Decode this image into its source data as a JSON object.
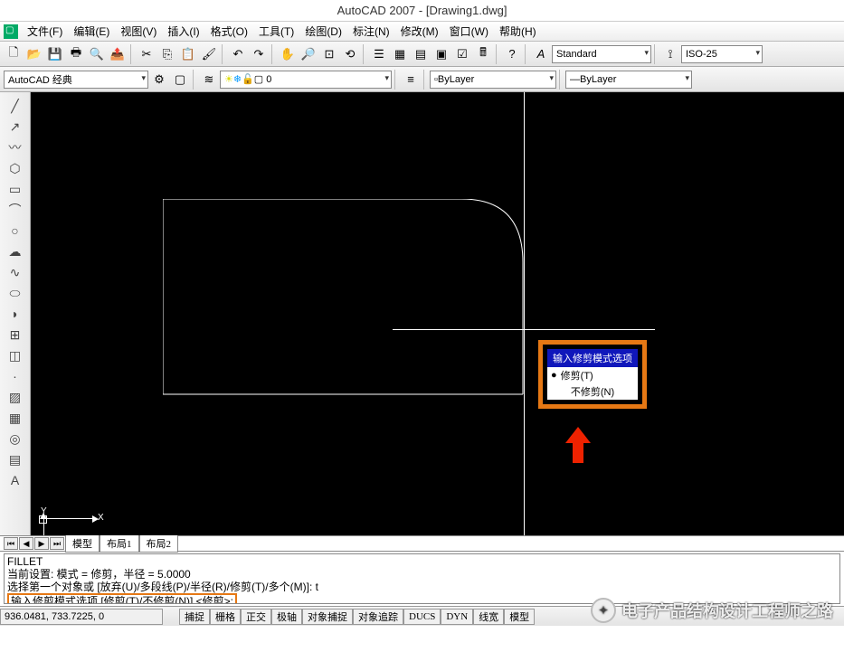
{
  "title": "AutoCAD 2007 - [Drawing1.dwg]",
  "menu": [
    "文件(F)",
    "编辑(E)",
    "视图(V)",
    "插入(I)",
    "格式(O)",
    "工具(T)",
    "绘图(D)",
    "标注(N)",
    "修改(M)",
    "窗口(W)",
    "帮助(H)"
  ],
  "workspace_dropdown": "AutoCAD 经典",
  "layer_dropdown": "0",
  "bylayer_dropdown": "ByLayer",
  "lineweight_label": "ByLayer",
  "style_dropdown": "Standard",
  "dimstyle_dropdown": "ISO-25",
  "popup": {
    "title": "输入修剪模式选项",
    "opt1": "修剪(T)",
    "opt2": "不修剪(N)"
  },
  "ucs": {
    "x": "X",
    "y": "Y"
  },
  "layout_tabs": [
    "模型",
    "布局1",
    "布局2"
  ],
  "cmd": {
    "l1": "FILLET",
    "l2": "当前设置: 模式 = 修剪，半径 = 5.0000",
    "l3": "选择第一个对象或 [放弃(U)/多段线(P)/半径(R)/修剪(T)/多个(M)]: t",
    "l4": "输入修剪模式选项 [修剪(T)/不修剪(N)] <修剪>:"
  },
  "status": {
    "coords": "936.0481, 733.7225, 0",
    "buttons": [
      "捕捉",
      "栅格",
      "正交",
      "极轴",
      "对象捕捉",
      "对象追踪",
      "DUCS",
      "DYN",
      "线宽",
      "模型"
    ]
  },
  "watermark": "电子产品结构设计工程师之路"
}
